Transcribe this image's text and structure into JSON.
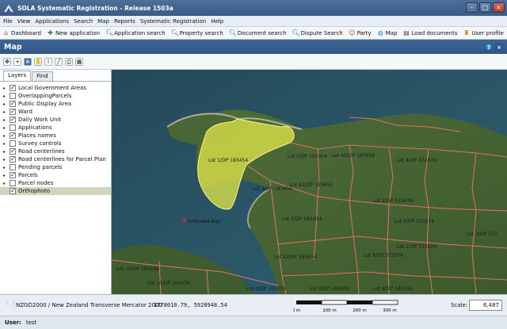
{
  "window": {
    "title": "SOLA Systematic Registration - Release 1503a"
  },
  "menu": [
    "File",
    "View",
    "Applications",
    "Search",
    "Map",
    "Reports",
    "Systematic Registration",
    "Help"
  ],
  "toolbar": [
    {
      "label": "Dashboard",
      "icon": "home-icon",
      "color": "#c0392b"
    },
    {
      "label": "New application",
      "icon": "new-application-icon",
      "color": "#2e7d32"
    },
    {
      "label": "Application search",
      "icon": "search-icon",
      "color": "#1565c0"
    },
    {
      "label": "Property search",
      "icon": "search-icon",
      "color": "#1565c0"
    },
    {
      "label": "Document search",
      "icon": "search-icon",
      "color": "#1565c0"
    },
    {
      "label": "Dispute Search",
      "icon": "search-icon",
      "color": "#1565c0"
    },
    {
      "label": "Party",
      "icon": "party-icon",
      "color": "#d35400"
    },
    {
      "label": "Map",
      "icon": "map-icon",
      "color": "#1e88e5"
    },
    {
      "label": "Load documents",
      "icon": "load-documents-icon",
      "color": "#6d4c41"
    },
    {
      "label": "User profile",
      "icon": "user-profile-icon",
      "color": "#c9820a"
    }
  ],
  "map_panel": {
    "title": "Map",
    "help": "?",
    "close": "×"
  },
  "map_tools": [
    {
      "icon": "pan-tool-icon",
      "glyph": "✥"
    },
    {
      "icon": "zoom-in-icon",
      "glyph": "+"
    },
    {
      "icon": "zoom-extent-icon",
      "glyph": "⊕"
    },
    {
      "icon": "hand-tool-icon",
      "glyph": "✋"
    },
    {
      "icon": "info-tool-icon",
      "glyph": "i"
    },
    {
      "icon": "measure-tool-icon",
      "glyph": "╱"
    },
    {
      "icon": "print-icon",
      "glyph": "⎙"
    },
    {
      "icon": "layers-export-icon",
      "glyph": "▦"
    }
  ],
  "layer_tabs": [
    "Layers",
    "Find"
  ],
  "layers": [
    {
      "name": "Local Government Areas",
      "checked": true
    },
    {
      "name": "OverlappingParcels",
      "checked": false
    },
    {
      "name": "Public Display Area",
      "checked": true
    },
    {
      "name": "Ward",
      "checked": true
    },
    {
      "name": "Daily Work Unit",
      "checked": true
    },
    {
      "name": "Applications",
      "checked": false
    },
    {
      "name": "Places names",
      "checked": true
    },
    {
      "name": "Survey controls",
      "checked": false
    },
    {
      "name": "Road centerlines",
      "checked": true
    },
    {
      "name": "Road centerlines for Parcel Plan",
      "checked": true
    },
    {
      "name": "Pending parcels",
      "checked": false
    },
    {
      "name": "Parcels",
      "checked": true
    },
    {
      "name": "Parcel nodes",
      "checked": false
    },
    {
      "name": "Orthophoto",
      "checked": true,
      "selected": true
    }
  ],
  "map": {
    "highlight_color": "#e4e84a",
    "parcel_line_color": "#e2735f",
    "place_label": "Orthoaka Bay",
    "parcel_labels": [
      "Lot 1/DP 183454",
      "Lot 5/DP 183454",
      "Lot 40/DP 183454",
      "Lot 4/DP 372676",
      "Lot 2/DP 183454",
      "Lot 43/DP 183454",
      "Lot 2/DP 372676",
      "Lot 3/DP 183454",
      "Lot 5/DP 372676",
      "Lot 3/DP 372",
      "Lot 6/DP 372676",
      "Lot 2/DP 372676",
      "Lot 42/DP 183454",
      "Lot 16/DP 183456",
      "Lot 15/DP 183456",
      "Lot 8/DP 183456",
      "Lot 9/DP 183456",
      "Lot 8/DP 183456"
    ]
  },
  "status": {
    "crs": "NZGD2000 / New Zealand Transverse Mercator 2000",
    "coords": "1778010.79, 5928948.54",
    "scale_ticks": [
      "0 m",
      "100 m",
      "200 m",
      "300 m"
    ],
    "scale_label": "Scale:",
    "scale_value": "6,487"
  },
  "user": {
    "label": "User:",
    "value": "test"
  }
}
